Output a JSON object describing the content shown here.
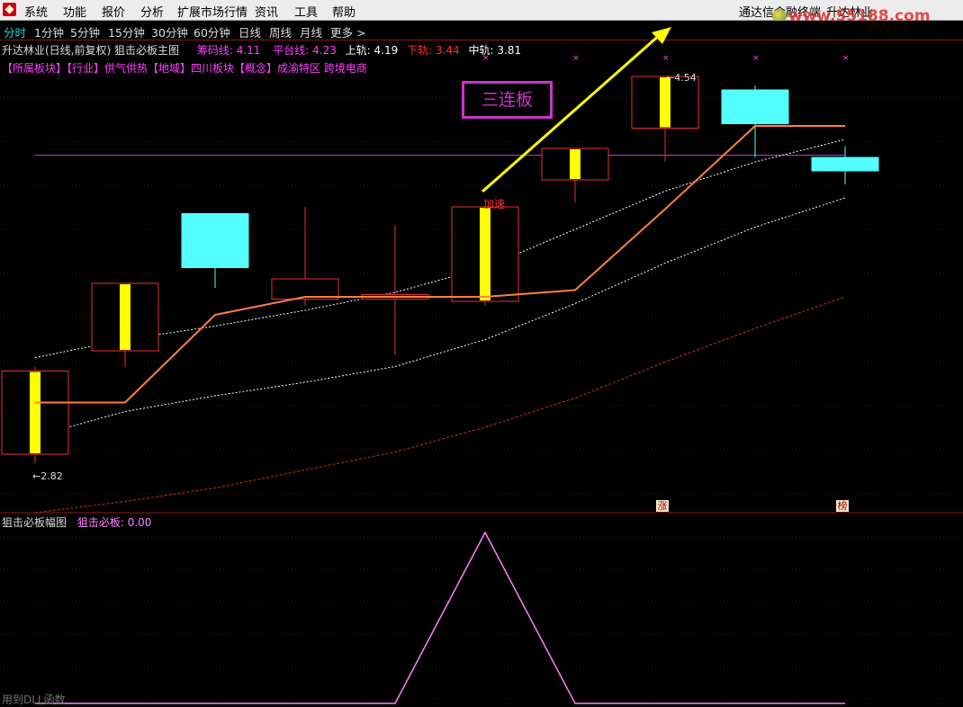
{
  "menubar": {
    "items": [
      "系统",
      "功能",
      "报价",
      "分析",
      "扩展市场行情",
      "资讯",
      "工具",
      "帮助"
    ],
    "right_app": "通达信金融终端",
    "right_stock": "升达林业",
    "watermark": "www.55188.com"
  },
  "periods": {
    "items": [
      "分时",
      "1分钟",
      "5分钟",
      "15分钟",
      "30分钟",
      "60分钟",
      "日线",
      "周线",
      "月线",
      "更多 >"
    ],
    "active": "分时"
  },
  "main_panel": {
    "title": "升达林业(日线,前复权) 狙击必板主图",
    "indicators": [
      {
        "label": "筹码线:",
        "value": "4.11",
        "color": "#ff40ff"
      },
      {
        "label": "平台线:",
        "value": "4.23",
        "color": "#ff40ff"
      },
      {
        "label": "上轨:",
        "value": "4.19",
        "color": "#ffffff"
      },
      {
        "label": "下轨:",
        "value": "3.44",
        "color": "#ff3030"
      },
      {
        "label": "中轨:",
        "value": "3.81",
        "color": "#ffffff"
      }
    ],
    "sectors": "【所属板块】【行业】供气供热【地域】四川板块【概念】成渝特区 跨境电商"
  },
  "annotations": {
    "box_label": "三连板",
    "accel_label": "加速",
    "low_label": "←2.82",
    "high_label": "←4.54",
    "limit_badge": "涨",
    "list_badge": "榜"
  },
  "sub_panel": {
    "title": "狙击必板幅图",
    "indicator_label": "狙击必板:",
    "indicator_value": "0.00",
    "footer": "用到DLL函数"
  },
  "colors": {
    "up_candle": "#e83030",
    "down_candle": "#54ffff",
    "marker_fill": "#ffff00",
    "platform_line": "#ff8040",
    "band_line": "#ffffff",
    "lower_band": "#d03020",
    "hline": "#cc33cc",
    "arrow": "#ffff00",
    "sub_line": "#ff80ff"
  },
  "chart_data": {
    "type": "candlestick",
    "price_range": [
      2.6,
      4.7
    ],
    "candles": [
      {
        "open": 2.86,
        "close": 3.23,
        "high": 3.25,
        "low": 2.82,
        "dir": "up",
        "marker": true
      },
      {
        "open": 3.32,
        "close": 3.62,
        "high": 3.62,
        "low": 3.25,
        "dir": "up",
        "marker": true
      },
      {
        "open": 3.93,
        "close": 3.69,
        "high": 3.93,
        "low": 3.6,
        "dir": "down",
        "marker": false
      },
      {
        "open": 3.55,
        "close": 3.64,
        "high": 3.96,
        "low": 3.52,
        "dir": "up",
        "marker": false
      },
      {
        "open": 3.55,
        "close": 3.57,
        "high": 3.88,
        "low": 3.3,
        "dir": "up",
        "marker": false
      },
      {
        "open": 3.54,
        "close": 3.96,
        "high": 3.96,
        "low": 3.52,
        "dir": "up",
        "marker": true
      },
      {
        "open": 4.08,
        "close": 4.22,
        "high": 4.22,
        "low": 3.98,
        "dir": "up",
        "marker": true
      },
      {
        "open": 4.31,
        "close": 4.54,
        "high": 4.54,
        "low": 4.16,
        "dir": "up",
        "marker": true
      },
      {
        "open": 4.48,
        "close": 4.33,
        "high": 4.5,
        "low": 4.18,
        "dir": "down",
        "marker": false
      },
      {
        "open": 4.18,
        "close": 4.12,
        "high": 4.23,
        "low": 4.06,
        "dir": "down",
        "marker": false
      }
    ],
    "platform_line": [
      3.09,
      3.09,
      3.48,
      3.56,
      3.56,
      3.56,
      3.59,
      3.95,
      4.32,
      4.32
    ],
    "upper_band": [
      3.29,
      3.37,
      3.43,
      3.5,
      3.58,
      3.69,
      3.86,
      4.03,
      4.16,
      4.26
    ],
    "middle_band": [
      2.94,
      3.05,
      3.12,
      3.18,
      3.25,
      3.37,
      3.53,
      3.71,
      3.87,
      4.0
    ],
    "lower_band": [
      2.6,
      2.65,
      2.71,
      2.79,
      2.87,
      2.98,
      3.11,
      3.27,
      3.42,
      3.56
    ],
    "platform_hline": 4.19,
    "x_marks": [
      5,
      6,
      7,
      8,
      9
    ],
    "sub_series": [
      0,
      0,
      0,
      0,
      0,
      1,
      0,
      0,
      0,
      0
    ]
  }
}
